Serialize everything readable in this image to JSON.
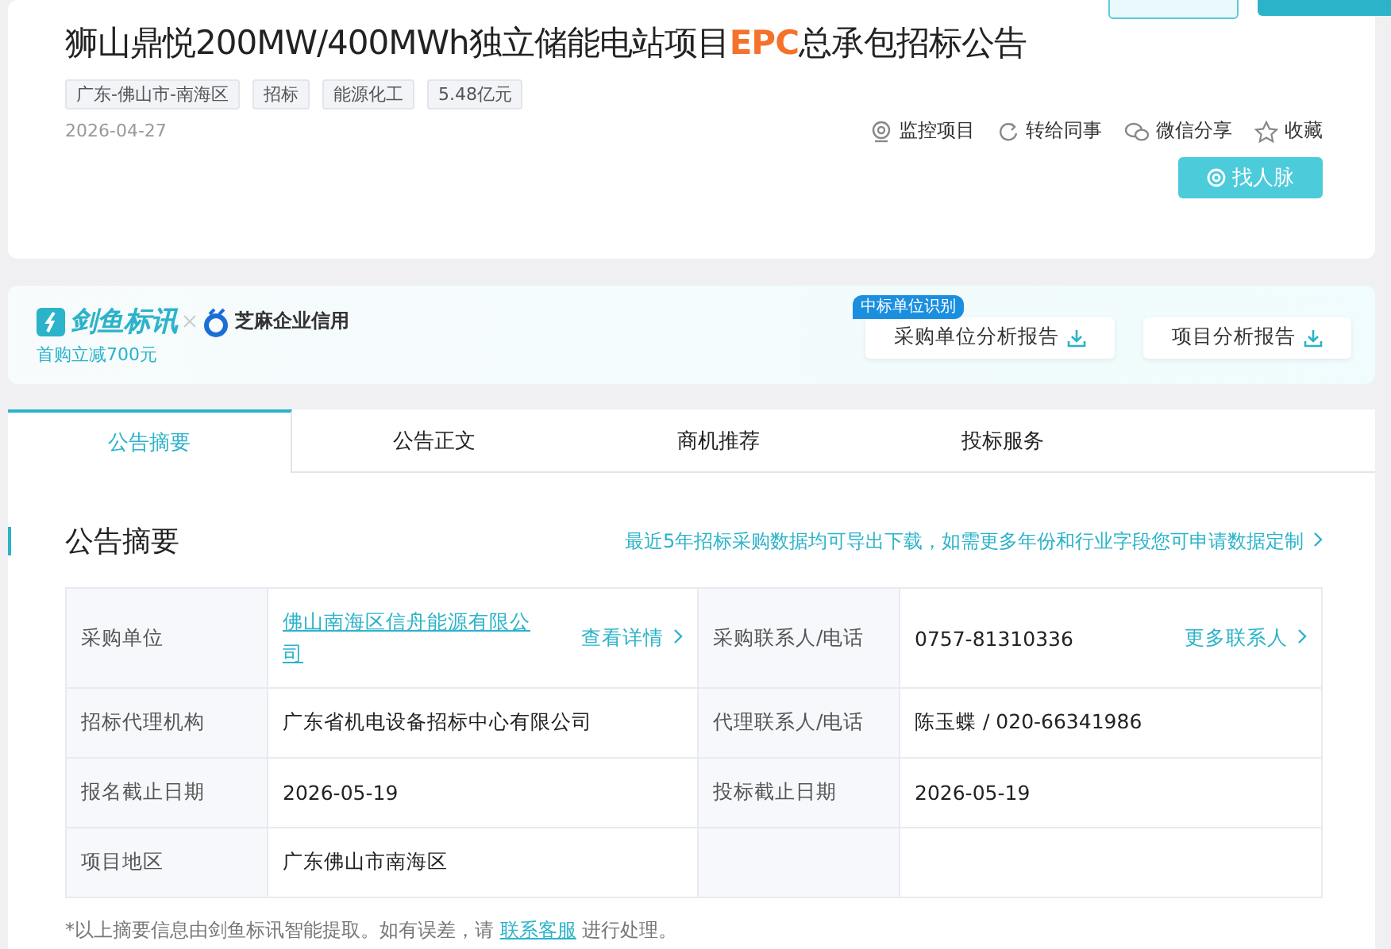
{
  "header": {
    "title": "狮山鼎悦200MW/400MWh独立储能电站项目**EPC**总承包招标公告",
    "tags": [
      "广东-佛山市-南海区",
      "招标",
      "能源化工",
      "5.48亿元"
    ],
    "date": "2026-04-27",
    "actions": [
      {
        "kind": "monitor",
        "label": "监控项目"
      },
      {
        "kind": "forward",
        "label": "转给同事"
      },
      {
        "kind": "wechat",
        "label": "微信分享"
      },
      {
        "kind": "star",
        "label": "收藏"
      }
    ],
    "find_button": "找人脉"
  },
  "banner": {
    "brand": "剑鱼标讯",
    "partner": "芝麻企业信用",
    "promo": "首购立减700元",
    "badge": "中标单位识别",
    "reports": [
      "采购单位分析报告",
      "项目分析报告"
    ]
  },
  "tabs": [
    {
      "label": "公告摘要",
      "selected": true
    },
    {
      "label": "公告正文",
      "selected": false
    },
    {
      "label": "商机推荐",
      "selected": false
    },
    {
      "label": "投标服务",
      "selected": false
    }
  ],
  "summary": {
    "heading": "公告摘要",
    "export_link": "最近5年招标采购数据均可导出下载，如需更多年份和行业字段您可申请数据定制",
    "rows": [
      [
        {
          "label": "采购单位",
          "value": "佛山南海区信舟能源有限公司",
          "kind": "link",
          "action": "查看详情"
        },
        {
          "label": "采购联系人/电话",
          "value": "0757-81310336",
          "kind": "text",
          "action": "更多联系人"
        }
      ],
      [
        {
          "label": "招标代理机构",
          "value": "广东省机电设备招标中心有限公司",
          "kind": "text"
        },
        {
          "label": "代理联系人/电话",
          "value": "陈玉蝶 / 020-66341986",
          "kind": "text"
        }
      ],
      [
        {
          "label": "报名截止日期",
          "value": "2026-05-19",
          "kind": "text"
        },
        {
          "label": "投标截止日期",
          "value": "2026-05-19",
          "kind": "text"
        }
      ],
      [
        {
          "label": "项目地区",
          "value": "广东佛山市南海区",
          "kind": "text"
        },
        {
          "kind": "empty"
        }
      ]
    ],
    "note_before": "*以上摘要信息由剑鱼标讯智能提取。如有误差，请",
    "note_link": "联系客服",
    "note_after": "进行处理。"
  }
}
